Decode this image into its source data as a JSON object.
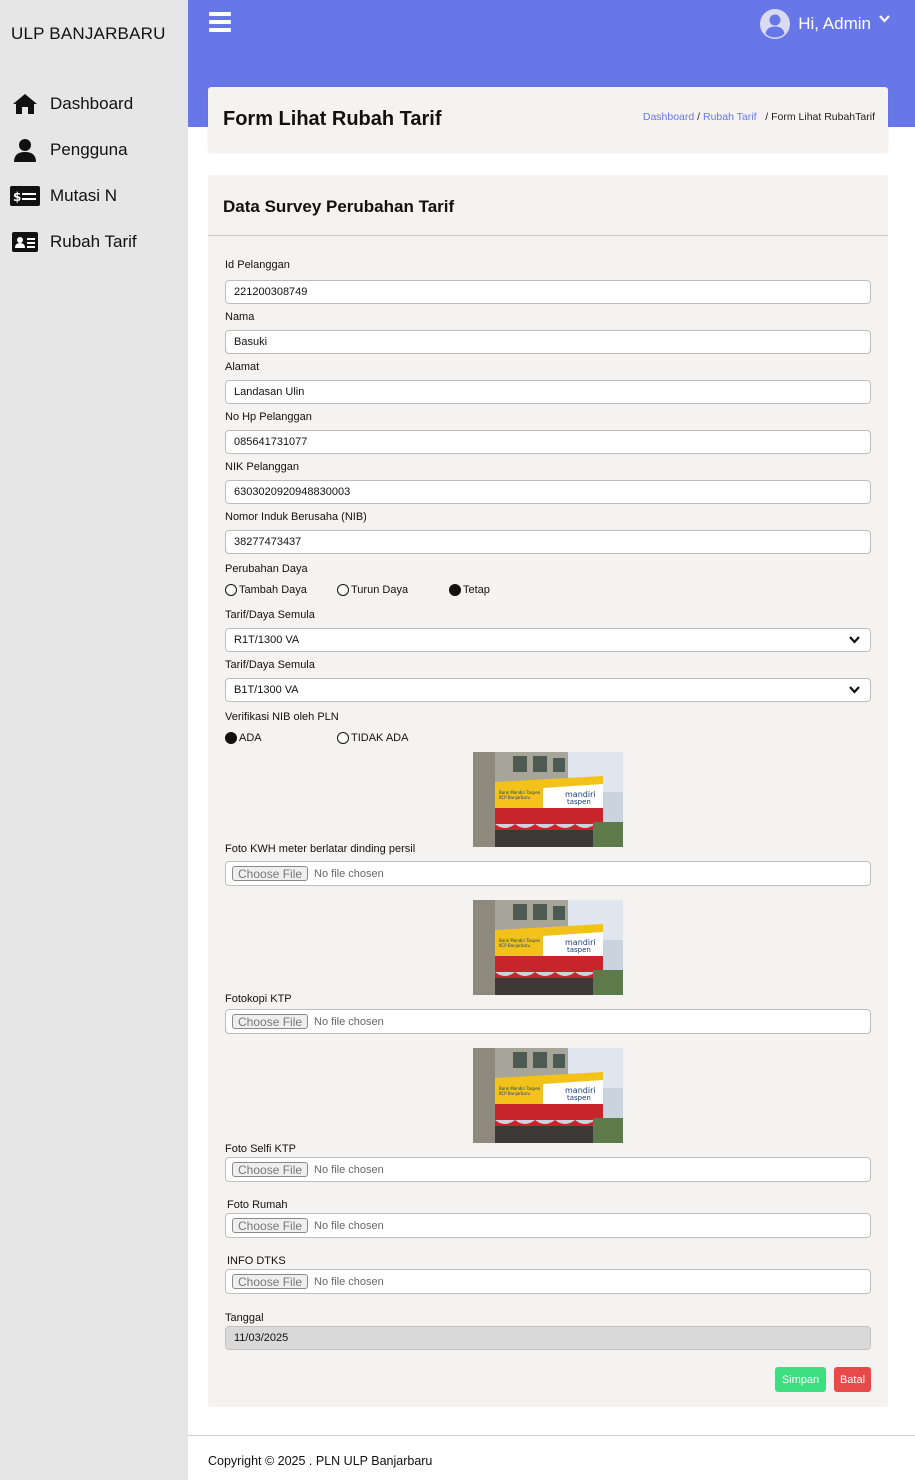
{
  "sidebar": {
    "brand": "ULP BANJARBARU",
    "items": [
      {
        "label": "Dashboard",
        "icon": "home-icon"
      },
      {
        "label": "Pengguna",
        "icon": "user-icon"
      },
      {
        "label": "Mutasi N",
        "icon": "money-icon"
      },
      {
        "label": "Rubah Tarif",
        "icon": "id-card-icon"
      }
    ]
  },
  "topbar": {
    "greeting": "Hi, Admin"
  },
  "page": {
    "title": "Form Lihat Rubah Tarif",
    "breadcrumb": [
      "Dashboard",
      "Rubah Tarif",
      "Form Lihat RubahTarif"
    ]
  },
  "form": {
    "title": "Data Survey Perubahan Tarif",
    "id_pelanggan": {
      "label": "Id Pelanggan",
      "value": "221200308749"
    },
    "nama": {
      "label": "Nama",
      "value": "Basuki"
    },
    "alamat": {
      "label": "Alamat",
      "value": "Landasan Ulin"
    },
    "no_hp": {
      "label": "No Hp Pelanggan",
      "value": "085641731077"
    },
    "nik": {
      "label": "NIK Pelanggan",
      "value": "6303020920948830003"
    },
    "nib": {
      "label": "Nomor Induk Berusaha (NIB)",
      "value": "38277473437"
    },
    "perubahan_daya": {
      "label": "Perubahan Daya",
      "options": [
        "Tambah Daya",
        "Turun Daya",
        "Tetap"
      ],
      "selected": "Tetap"
    },
    "tarif_semula": {
      "label": "Tarif/Daya Semula",
      "value": "R1T/1300 VA"
    },
    "tarif_baru": {
      "label": "Tarif/Daya Semula",
      "value": "B1T/1300 VA"
    },
    "verifikasi_nib": {
      "label": "Verifikasi NIB oleh PLN",
      "options": [
        "ADA",
        "TIDAK ADA"
      ],
      "selected": "ADA"
    },
    "file_button": "Choose File",
    "file_status": "No file chosen",
    "uploads": [
      {
        "label": "Foto KWH meter berlatar dinding persil"
      },
      {
        "label": "Fotokopi KTP"
      },
      {
        "label": "Foto Selfi KTP"
      },
      {
        "label": "Foto Rumah"
      },
      {
        "label": "INFO DTKS"
      }
    ],
    "photo_sign": {
      "line1": "Bank Mandiri Taspen",
      "line2": "KCP Banjarbaru",
      "brand1": "mandiri",
      "brand2": "taspen"
    },
    "tanggal": {
      "label": "Tanggal",
      "value": "11/03/2025"
    },
    "save_label": "Simpan",
    "cancel_label": "Batal"
  },
  "footer": {
    "text": "Copyright © 2025 . PLN ULP Banjarbaru"
  },
  "colors": {
    "accent": "#6877e8",
    "sidebar_bg": "#e6e6e6",
    "card_bg": "#f5f2f2",
    "save": "#3dde80",
    "cancel": "#e84a4a"
  }
}
